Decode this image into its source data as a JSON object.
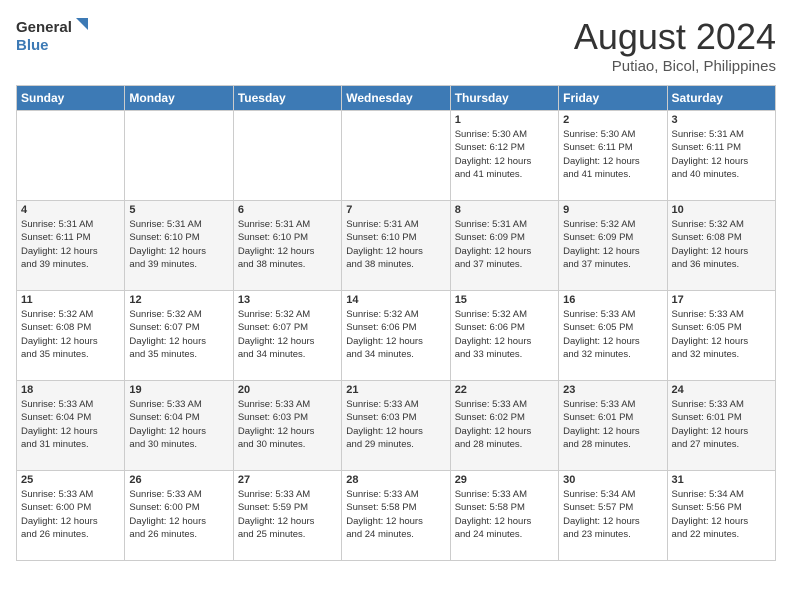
{
  "logo": {
    "line1": "General",
    "line2": "Blue"
  },
  "title": "August 2024",
  "subtitle": "Putiao, Bicol, Philippines",
  "days_of_week": [
    "Sunday",
    "Monday",
    "Tuesday",
    "Wednesday",
    "Thursday",
    "Friday",
    "Saturday"
  ],
  "weeks": [
    [
      {
        "day": "",
        "info": ""
      },
      {
        "day": "",
        "info": ""
      },
      {
        "day": "",
        "info": ""
      },
      {
        "day": "",
        "info": ""
      },
      {
        "day": "1",
        "info": "Sunrise: 5:30 AM\nSunset: 6:12 PM\nDaylight: 12 hours\nand 41 minutes."
      },
      {
        "day": "2",
        "info": "Sunrise: 5:30 AM\nSunset: 6:11 PM\nDaylight: 12 hours\nand 41 minutes."
      },
      {
        "day": "3",
        "info": "Sunrise: 5:31 AM\nSunset: 6:11 PM\nDaylight: 12 hours\nand 40 minutes."
      }
    ],
    [
      {
        "day": "4",
        "info": "Sunrise: 5:31 AM\nSunset: 6:11 PM\nDaylight: 12 hours\nand 39 minutes."
      },
      {
        "day": "5",
        "info": "Sunrise: 5:31 AM\nSunset: 6:10 PM\nDaylight: 12 hours\nand 39 minutes."
      },
      {
        "day": "6",
        "info": "Sunrise: 5:31 AM\nSunset: 6:10 PM\nDaylight: 12 hours\nand 38 minutes."
      },
      {
        "day": "7",
        "info": "Sunrise: 5:31 AM\nSunset: 6:10 PM\nDaylight: 12 hours\nand 38 minutes."
      },
      {
        "day": "8",
        "info": "Sunrise: 5:31 AM\nSunset: 6:09 PM\nDaylight: 12 hours\nand 37 minutes."
      },
      {
        "day": "9",
        "info": "Sunrise: 5:32 AM\nSunset: 6:09 PM\nDaylight: 12 hours\nand 37 minutes."
      },
      {
        "day": "10",
        "info": "Sunrise: 5:32 AM\nSunset: 6:08 PM\nDaylight: 12 hours\nand 36 minutes."
      }
    ],
    [
      {
        "day": "11",
        "info": "Sunrise: 5:32 AM\nSunset: 6:08 PM\nDaylight: 12 hours\nand 35 minutes."
      },
      {
        "day": "12",
        "info": "Sunrise: 5:32 AM\nSunset: 6:07 PM\nDaylight: 12 hours\nand 35 minutes."
      },
      {
        "day": "13",
        "info": "Sunrise: 5:32 AM\nSunset: 6:07 PM\nDaylight: 12 hours\nand 34 minutes."
      },
      {
        "day": "14",
        "info": "Sunrise: 5:32 AM\nSunset: 6:06 PM\nDaylight: 12 hours\nand 34 minutes."
      },
      {
        "day": "15",
        "info": "Sunrise: 5:32 AM\nSunset: 6:06 PM\nDaylight: 12 hours\nand 33 minutes."
      },
      {
        "day": "16",
        "info": "Sunrise: 5:33 AM\nSunset: 6:05 PM\nDaylight: 12 hours\nand 32 minutes."
      },
      {
        "day": "17",
        "info": "Sunrise: 5:33 AM\nSunset: 6:05 PM\nDaylight: 12 hours\nand 32 minutes."
      }
    ],
    [
      {
        "day": "18",
        "info": "Sunrise: 5:33 AM\nSunset: 6:04 PM\nDaylight: 12 hours\nand 31 minutes."
      },
      {
        "day": "19",
        "info": "Sunrise: 5:33 AM\nSunset: 6:04 PM\nDaylight: 12 hours\nand 30 minutes."
      },
      {
        "day": "20",
        "info": "Sunrise: 5:33 AM\nSunset: 6:03 PM\nDaylight: 12 hours\nand 30 minutes."
      },
      {
        "day": "21",
        "info": "Sunrise: 5:33 AM\nSunset: 6:03 PM\nDaylight: 12 hours\nand 29 minutes."
      },
      {
        "day": "22",
        "info": "Sunrise: 5:33 AM\nSunset: 6:02 PM\nDaylight: 12 hours\nand 28 minutes."
      },
      {
        "day": "23",
        "info": "Sunrise: 5:33 AM\nSunset: 6:01 PM\nDaylight: 12 hours\nand 28 minutes."
      },
      {
        "day": "24",
        "info": "Sunrise: 5:33 AM\nSunset: 6:01 PM\nDaylight: 12 hours\nand 27 minutes."
      }
    ],
    [
      {
        "day": "25",
        "info": "Sunrise: 5:33 AM\nSunset: 6:00 PM\nDaylight: 12 hours\nand 26 minutes."
      },
      {
        "day": "26",
        "info": "Sunrise: 5:33 AM\nSunset: 6:00 PM\nDaylight: 12 hours\nand 26 minutes."
      },
      {
        "day": "27",
        "info": "Sunrise: 5:33 AM\nSunset: 5:59 PM\nDaylight: 12 hours\nand 25 minutes."
      },
      {
        "day": "28",
        "info": "Sunrise: 5:33 AM\nSunset: 5:58 PM\nDaylight: 12 hours\nand 24 minutes."
      },
      {
        "day": "29",
        "info": "Sunrise: 5:33 AM\nSunset: 5:58 PM\nDaylight: 12 hours\nand 24 minutes."
      },
      {
        "day": "30",
        "info": "Sunrise: 5:34 AM\nSunset: 5:57 PM\nDaylight: 12 hours\nand 23 minutes."
      },
      {
        "day": "31",
        "info": "Sunrise: 5:34 AM\nSunset: 5:56 PM\nDaylight: 12 hours\nand 22 minutes."
      }
    ]
  ]
}
